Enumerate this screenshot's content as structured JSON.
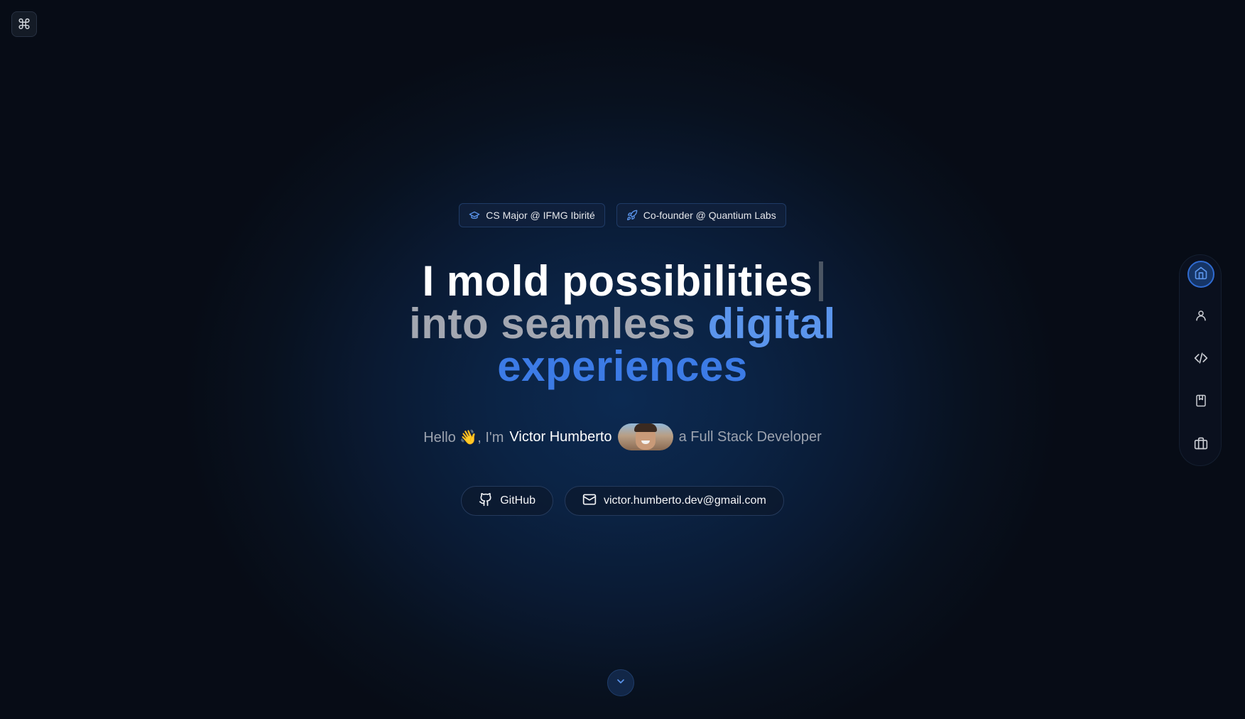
{
  "command_button": {
    "glyph": "⌘",
    "icon": "command-icon"
  },
  "badges": [
    {
      "label": "CS Major @ IFMG Ibirité",
      "icon": "graduation-cap-icon",
      "icon_color": "#5b95ec"
    },
    {
      "label": "Co-founder @ Quantium Labs",
      "icon": "rocket-icon",
      "icon_color": "#5b95ec"
    }
  ],
  "headline": {
    "line1": "I mold possibilities",
    "line2_grey": "into seamless",
    "line2_blue": "digital",
    "line3_blue": "experiences"
  },
  "intro": {
    "hello": "Hello",
    "wave": "👋",
    "im": ", I'm",
    "name": "Victor Humberto",
    "role": "a Full Stack Developer"
  },
  "links": [
    {
      "label": "GitHub",
      "icon": "github-icon"
    },
    {
      "label": "victor.humberto.dev@gmail.com",
      "icon": "mail-icon"
    }
  ],
  "side_nav": {
    "items": [
      {
        "icon": "home-icon",
        "active": true
      },
      {
        "icon": "user-icon",
        "active": false
      },
      {
        "icon": "code-icon",
        "active": false
      },
      {
        "icon": "bookmark-icon",
        "active": false
      },
      {
        "icon": "briefcase-icon",
        "active": false
      }
    ]
  },
  "scroll_down": {
    "icon": "chevron-down-icon"
  },
  "colors": {
    "accent": "#3c7be6",
    "accent_light": "#5b95ec",
    "headline_white": "#ffffff",
    "headline_grey": "#a3a7b1",
    "background": "#0b1a33"
  }
}
